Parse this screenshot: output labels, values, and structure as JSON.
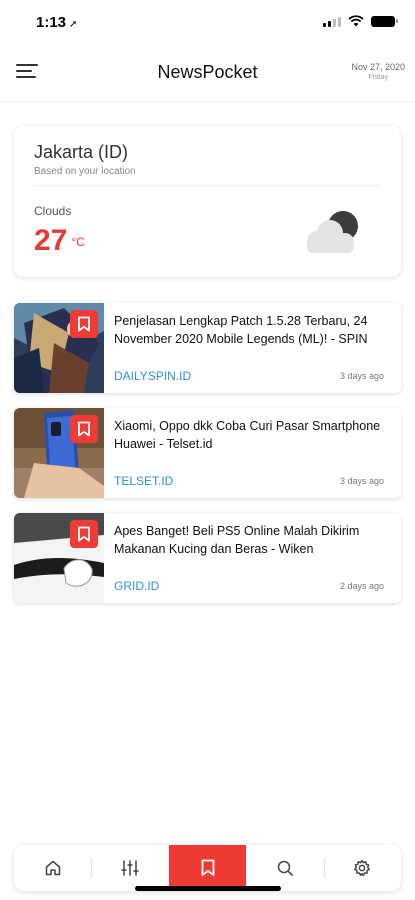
{
  "status_bar": {
    "time": "1:13",
    "location_glyph": "➚"
  },
  "header": {
    "title": "NewsPocket",
    "date": "Nov 27, 2020",
    "day": "Friday"
  },
  "weather": {
    "city": "Jakarta (ID)",
    "note": "Based on your location",
    "condition": "Clouds",
    "temperature": "27",
    "unit": "°C",
    "icon": "cloud-night-icon"
  },
  "news": [
    {
      "title": "Penjelasan Lengkap Patch 1.5.28 Terbaru, 24 November 2020 Mobile Legends (ML)! - SPIN",
      "source": "DAILYSPIN.ID",
      "time": "3 days ago"
    },
    {
      "title": "Xiaomi, Oppo dkk Coba Curi Pasar Smartphone Huawei - Telset.id",
      "source": "TELSET.ID",
      "time": "3 days ago"
    },
    {
      "title": "Apes Banget! Beli PS5 Online Malah Dikirim Makanan Kucing dan Beras - Wiken",
      "source": "GRID.ID",
      "time": "2 days ago"
    }
  ],
  "nav": {
    "items": [
      "home-icon",
      "sliders-icon",
      "bookmark-icon",
      "search-icon",
      "gear-icon"
    ],
    "active": "bookmark-icon"
  },
  "colors": {
    "accent": "#ef3b36",
    "temperature": "#e53935",
    "source_link": "#2f8fd9"
  }
}
